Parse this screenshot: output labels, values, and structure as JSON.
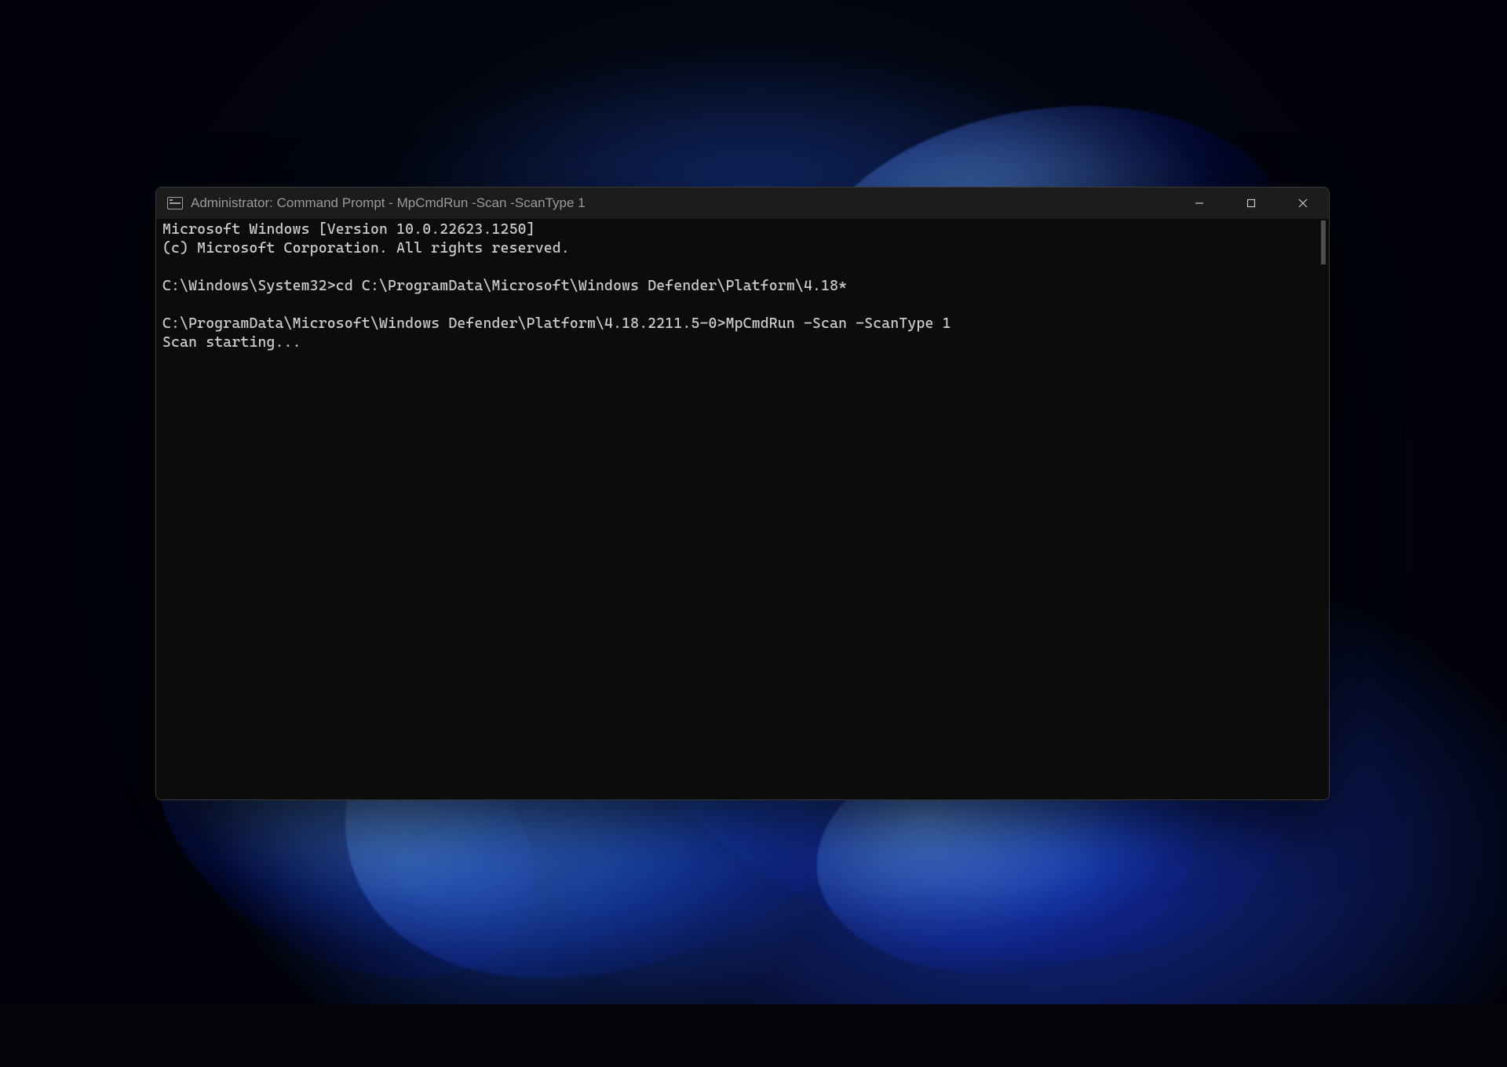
{
  "titlebar": {
    "icon_name": "cmd-prompt-icon",
    "title": "Administrator: Command Prompt - MpCmdRun  -Scan -ScanType 1",
    "minimize_label": "Minimize",
    "maximize_label": "Maximize",
    "close_label": "Close"
  },
  "terminal": {
    "lines": [
      "Microsoft Windows [Version 10.0.22623.1250]",
      "(c) Microsoft Corporation. All rights reserved.",
      "",
      "C:\\Windows\\System32>cd C:\\ProgramData\\Microsoft\\Windows Defender\\Platform\\4.18*",
      "",
      "C:\\ProgramData\\Microsoft\\Windows Defender\\Platform\\4.18.2211.5-0>MpCmdRun -Scan -ScanType 1",
      "Scan starting..."
    ]
  },
  "colors": {
    "titlebar_bg": "#1c1c1c",
    "titlebar_fg": "#9a9a9a",
    "terminal_bg": "#0c0c0c",
    "terminal_fg": "#cccccc"
  }
}
